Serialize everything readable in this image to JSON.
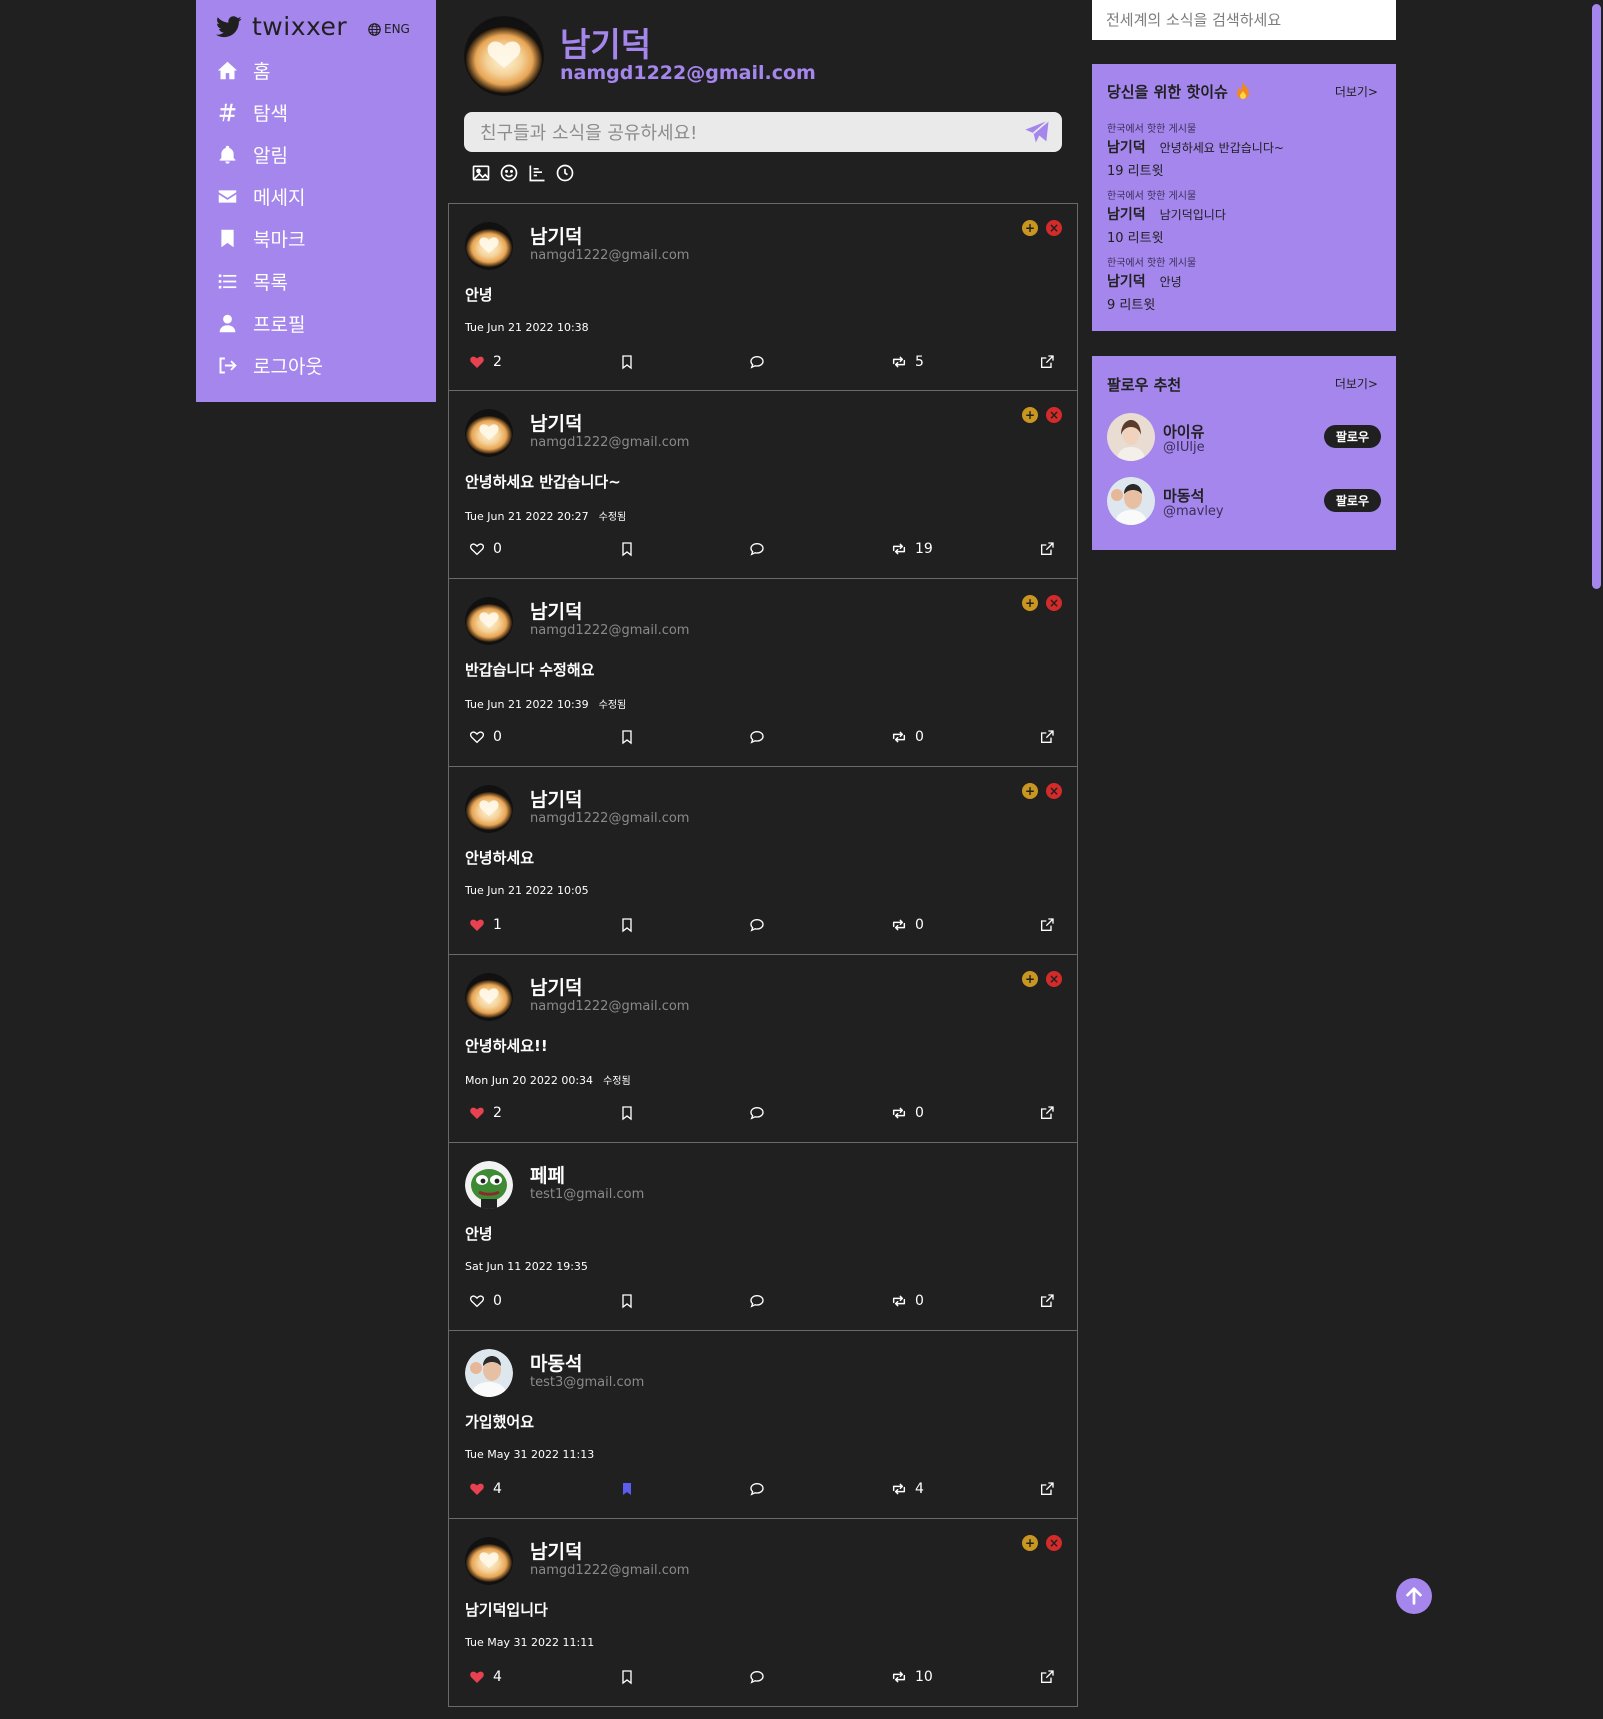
{
  "brand": {
    "name": "twixxer",
    "lang": "ENG"
  },
  "nav": [
    {
      "label": "홈",
      "icon": "home-icon"
    },
    {
      "label": "탐색",
      "icon": "hashtag-icon"
    },
    {
      "label": "알림",
      "icon": "bell-icon"
    },
    {
      "label": "메세지",
      "icon": "envelope-icon"
    },
    {
      "label": "북마크",
      "icon": "bookmark-icon"
    },
    {
      "label": "목록",
      "icon": "list-icon"
    },
    {
      "label": "프로필",
      "icon": "user-icon"
    },
    {
      "label": "로그아웃",
      "icon": "logout-icon"
    }
  ],
  "profile": {
    "name": "남기덕",
    "email": "namgd1222@gmail.com"
  },
  "compose": {
    "placeholder": "친구들과 소식을 공유하세요!"
  },
  "posts": [
    {
      "name": "남기덕",
      "email": "namgd1222@gmail.com",
      "text": "안녕",
      "date": "Tue Jun 21 2022 10:38",
      "edited": "",
      "likes": "2",
      "liked": true,
      "bookmarked": false,
      "retweets": "5",
      "own": true,
      "avatar": "latte"
    },
    {
      "name": "남기덕",
      "email": "namgd1222@gmail.com",
      "text": "안녕하세요 반갑습니다~",
      "date": "Tue Jun 21 2022 20:27",
      "edited": "수정됨",
      "likes": "0",
      "liked": false,
      "bookmarked": false,
      "retweets": "19",
      "own": true,
      "avatar": "latte"
    },
    {
      "name": "남기덕",
      "email": "namgd1222@gmail.com",
      "text": "반갑습니다 수정해요",
      "date": "Tue Jun 21 2022 10:39",
      "edited": "수정됨",
      "likes": "0",
      "liked": false,
      "bookmarked": false,
      "retweets": "0",
      "own": true,
      "avatar": "latte"
    },
    {
      "name": "남기덕",
      "email": "namgd1222@gmail.com",
      "text": "안녕하세요",
      "date": "Tue Jun 21 2022 10:05",
      "edited": "",
      "likes": "1",
      "liked": true,
      "bookmarked": false,
      "retweets": "0",
      "own": true,
      "avatar": "latte"
    },
    {
      "name": "남기덕",
      "email": "namgd1222@gmail.com",
      "text": "안녕하세요!!",
      "date": "Mon Jun 20 2022 00:34",
      "edited": "수정됨",
      "likes": "2",
      "liked": true,
      "bookmarked": false,
      "retweets": "0",
      "own": true,
      "avatar": "latte"
    },
    {
      "name": "페페",
      "email": "test1@gmail.com",
      "text": "안녕",
      "date": "Sat Jun 11 2022 19:35",
      "edited": "",
      "likes": "0",
      "liked": false,
      "bookmarked": false,
      "retweets": "0",
      "own": false,
      "avatar": "frog"
    },
    {
      "name": "마동석",
      "email": "test3@gmail.com",
      "text": "가입했어요",
      "date": "Tue May 31 2022 11:13",
      "edited": "",
      "likes": "4",
      "liked": true,
      "bookmarked": true,
      "retweets": "4",
      "own": false,
      "avatar": "person"
    },
    {
      "name": "남기덕",
      "email": "namgd1222@gmail.com",
      "text": "남기덕입니다",
      "date": "Tue May 31 2022 11:11",
      "edited": "",
      "likes": "4",
      "liked": true,
      "bookmarked": false,
      "retweets": "10",
      "own": true,
      "avatar": "latte"
    }
  ],
  "search": {
    "placeholder": "전세계의 소식을 검색하세요"
  },
  "trends": {
    "title": "당신을 위한 핫이슈",
    "more": "더보기>",
    "items": [
      {
        "caption": "한국에서 핫한 게시물",
        "name": "남기덕",
        "text": "안녕하세요 반갑습니다~",
        "count": "19 리트윗"
      },
      {
        "caption": "한국에서 핫한 게시물",
        "name": "남기덕",
        "text": "남기덕입니다",
        "count": "10 리트윗"
      },
      {
        "caption": "한국에서 핫한 게시물",
        "name": "남기덕",
        "text": "안녕",
        "count": "9 리트윗"
      }
    ]
  },
  "follow": {
    "title": "팔로우 추천",
    "more": "더보기>",
    "items": [
      {
        "name": "아이유",
        "handle": "@IUlje",
        "button": "팔로우"
      },
      {
        "name": "마동석",
        "handle": "@mavley",
        "button": "팔로우"
      }
    ]
  },
  "colors": {
    "accent": "#a586ec",
    "background": "#202021",
    "like": "#e8414f",
    "bookmark": "#5b5ef0"
  }
}
